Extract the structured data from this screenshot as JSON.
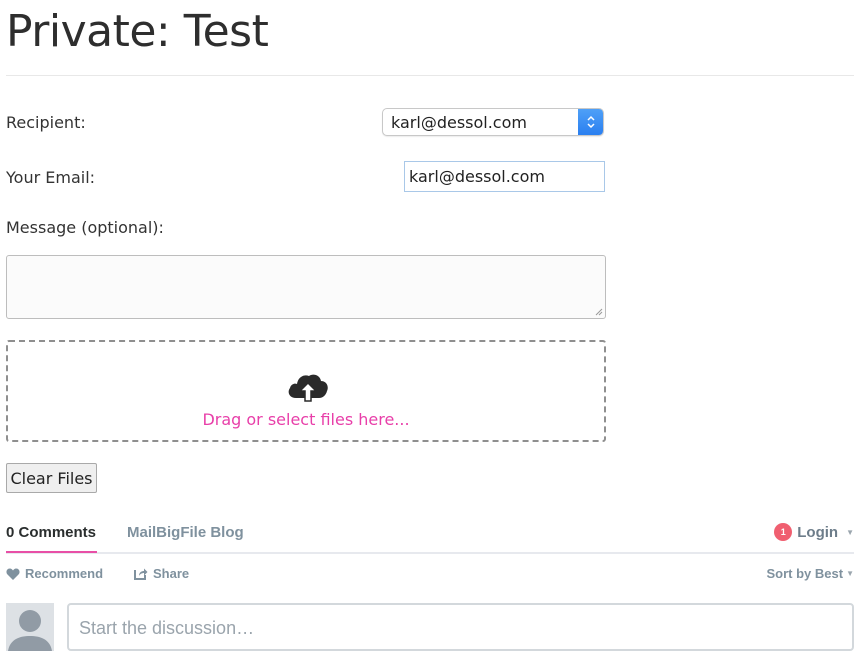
{
  "page": {
    "title": "Private: Test"
  },
  "form": {
    "recipient_label": "Recipient:",
    "recipient_value": "karl@dessol.com",
    "email_label": "Your Email:",
    "email_value": "karl@dessol.com",
    "message_label": "Message (optional):",
    "message_value": "",
    "dropzone_text": "Drag or select files here...",
    "clear_button": "Clear Files"
  },
  "comments": {
    "tab_comments": "0 Comments",
    "tab_site": "MailBigFile Blog",
    "notification_count": "1",
    "login_label": "Login",
    "recommend_label": "Recommend",
    "share_label": "Share",
    "sort_label": "Sort by Best",
    "placeholder": "Start the discussion…"
  },
  "colors": {
    "accent_pink": "#e83fa9",
    "badge_red": "#f05f70",
    "select_blue": "#2a7ff0"
  }
}
